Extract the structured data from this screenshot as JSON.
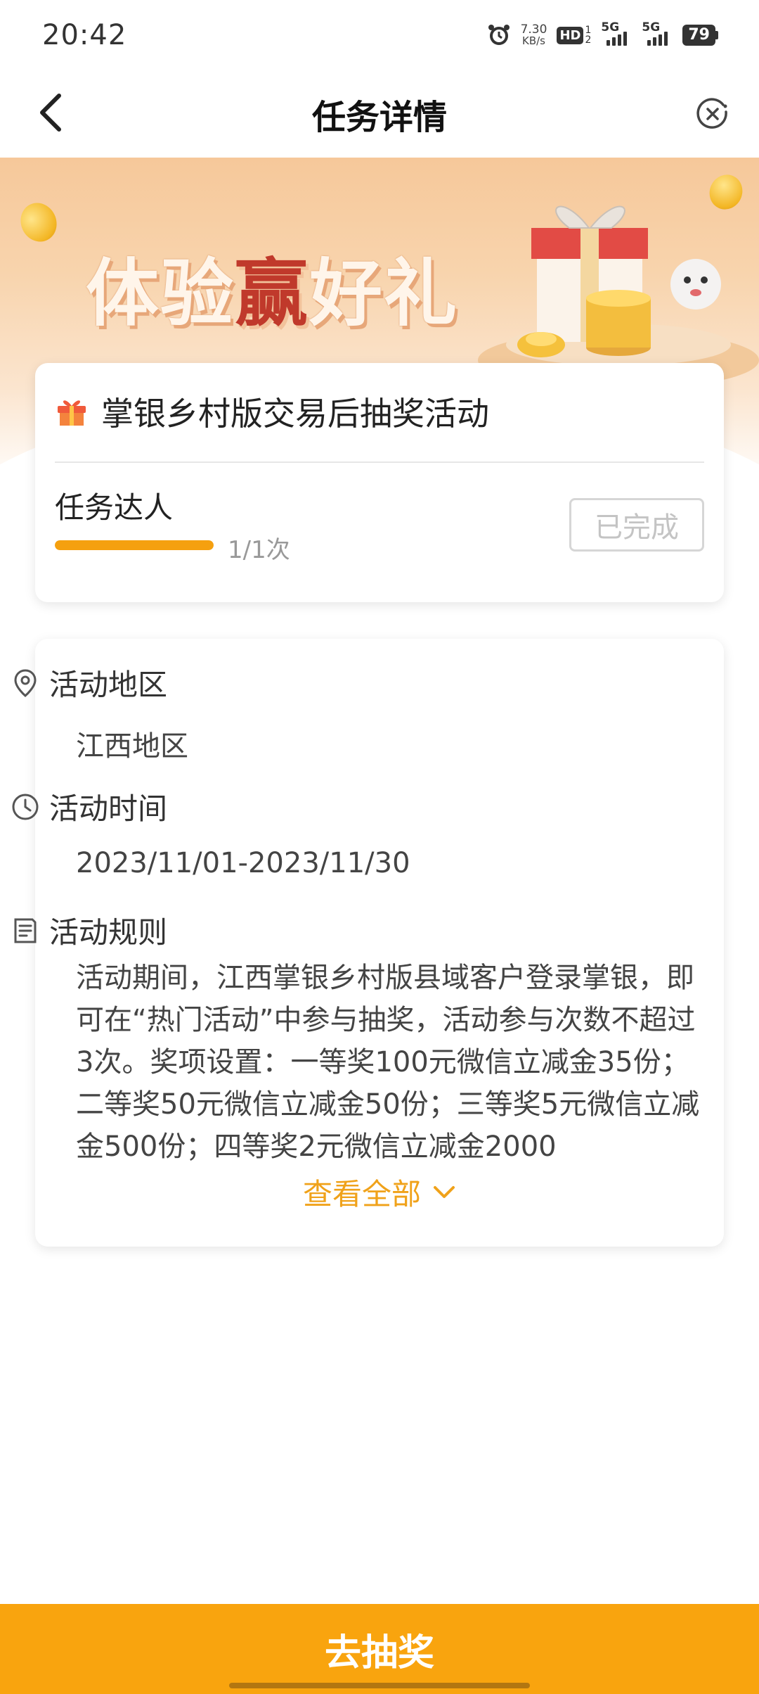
{
  "status_bar": {
    "time": "20:42",
    "net_speed_value": "7.30",
    "net_speed_unit": "KB/s",
    "hd_label": "HD",
    "hd_sub_top": "1",
    "hd_sub_bottom": "2",
    "signal_1": "5G",
    "signal_2": "5G",
    "battery": "79"
  },
  "nav": {
    "title": "任务详情"
  },
  "banner": {
    "title_part1": "体验",
    "title_highlight": "赢",
    "title_part2": "好礼"
  },
  "task": {
    "name": "掌银乡村版交易后抽奖活动",
    "sub_title": "任务达人",
    "progress_fraction": 1.0,
    "progress_text": "1/1次",
    "status_button": "已完成"
  },
  "info": {
    "region_label": "活动地区",
    "region_value": "江西地区",
    "time_label": "活动时间",
    "time_value": "2023/11/01-2023/11/30",
    "rules_label": "活动规则",
    "rules_text": "活动期间，江西掌银乡村版县域客户登录掌银，即可在“热门活动”中参与抽奖，活动参与次数不超过3次。奖项设置：一等奖100元微信立减金35份；二等奖50元微信立减金50份；三等奖5元微信立减金500份；四等奖2元微信立减金2000",
    "view_all": "查看全部"
  },
  "bottom": {
    "action_button": "去抽奖"
  },
  "colors": {
    "accent": "#f9a40e",
    "link": "#f0a21a",
    "highlight_red": "#c0392b"
  }
}
